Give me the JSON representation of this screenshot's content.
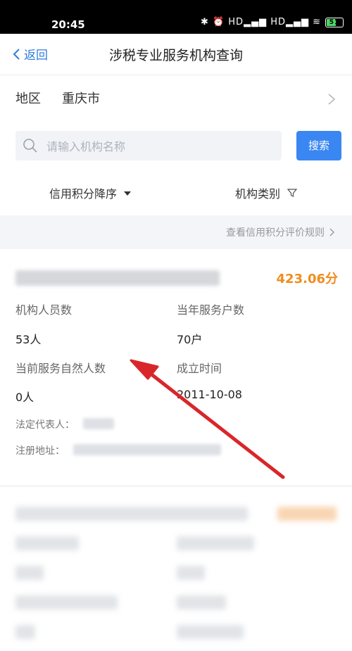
{
  "status_bar": {
    "time": "20:45",
    "icons": "✱ ⏰ HD▂▄▆ HD▂▄▆ ≋",
    "battery": "51"
  },
  "nav": {
    "back_label": "返回",
    "title": "涉税专业服务机构查询"
  },
  "region": {
    "label": "地区",
    "value": "重庆市"
  },
  "search": {
    "placeholder": "请输入机构名称",
    "button_label": "搜索"
  },
  "filters": {
    "sort_label": "信用积分降序",
    "category_label": "机构类别"
  },
  "rules_link": "查看信用积分评价规则",
  "cards": [
    {
      "score": "423.06分",
      "staff_label": "机构人员数",
      "staff_value": "53人",
      "clients_label": "当年服务户数",
      "clients_value": "70户",
      "natural_label": "当前服务自然人数",
      "natural_value": "0人",
      "founded_label": "成立时间",
      "founded_value": "2011-10-08",
      "rep_label": "法定代表人：",
      "address_label": "注册地址："
    }
  ],
  "colors": {
    "accent": "#3a86f2",
    "score": "#f08c1e",
    "arrow": "#d9262a"
  }
}
